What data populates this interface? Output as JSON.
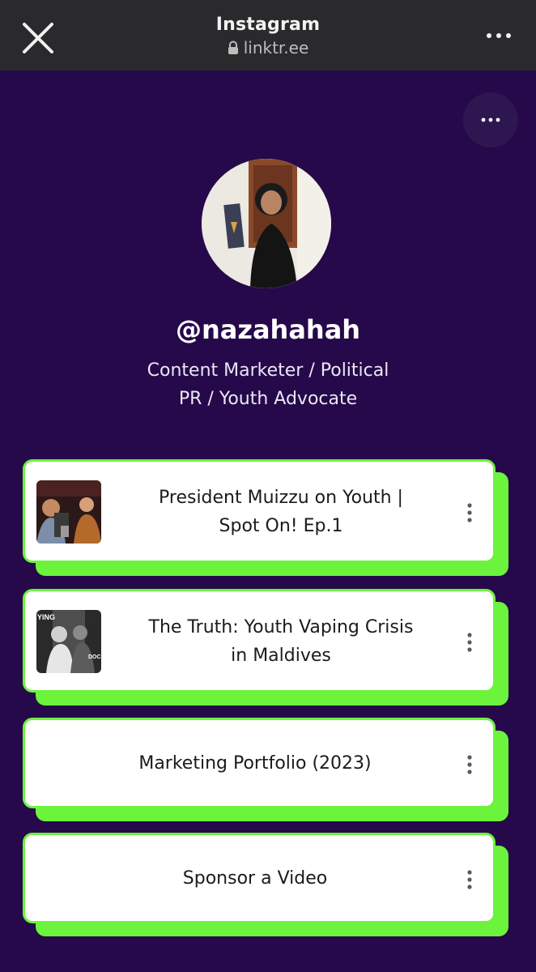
{
  "browser": {
    "title": "Instagram",
    "url": "linktr.ee"
  },
  "profile": {
    "handle": "@nazahahah",
    "bio_line1": "Content Marketer / Political",
    "bio_line2": "PR / Youth Advocate"
  },
  "links": [
    {
      "line1": "President Muizzu on Youth |",
      "line2": "Spot On! Ep.1",
      "has_thumb": true
    },
    {
      "line1": "The Truth: Youth Vaping Crisis",
      "line2": "in Maldives",
      "has_thumb": true,
      "thumb_text_left": "YING",
      "thumb_text_right": "DOC"
    },
    {
      "label": "Marketing Portfolio (2023)"
    },
    {
      "label": "Sponsor a Video"
    }
  ],
  "colors": {
    "page_bg": "#26094a",
    "card_border": "#6cf33c",
    "topbar_bg": "#2a2a2c"
  },
  "icons": {
    "close": "close-icon",
    "lock": "lock-icon",
    "more": "more-horizontal-icon",
    "share": "more-horizontal-icon",
    "card_menu": "more-vertical-icon"
  }
}
